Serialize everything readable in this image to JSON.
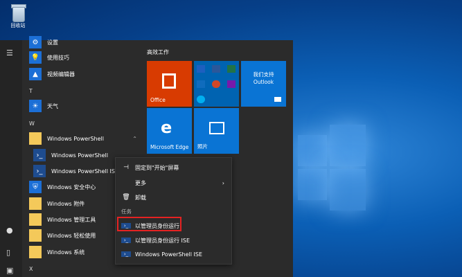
{
  "desktop": {
    "recycle_bin_label": "回收站"
  },
  "rail": {
    "icons": [
      "hamburger-icon",
      "user-icon",
      "document-icon",
      "pictures-icon"
    ]
  },
  "applist": {
    "rows": [
      {
        "label": "设置",
        "icon": "gear-icon"
      },
      {
        "label": "使用技巧",
        "icon": "lightbulb-icon"
      },
      {
        "label": "视频编辑器",
        "icon": "photos-icon"
      },
      {
        "label": "天气",
        "icon": "weather-icon"
      },
      {
        "label": "Windows PowerShell",
        "icon": "folder-icon"
      },
      {
        "label": "Windows PowerShell",
        "icon": "powershell-icon"
      },
      {
        "label": "Windows PowerShell ISE",
        "icon": "powershell-ise-icon"
      },
      {
        "label": "Windows 安全中心",
        "icon": "shield-icon"
      },
      {
        "label": "Windows 附件",
        "icon": "folder-icon"
      },
      {
        "label": "Windows 管理工具",
        "icon": "folder-icon"
      },
      {
        "label": "Windows 轻松使用",
        "icon": "folder-icon"
      },
      {
        "label": "Windows 系统",
        "icon": "folder-icon"
      }
    ],
    "letters": [
      "T",
      "W",
      "X"
    ]
  },
  "tiles": {
    "group_title": "高效工作",
    "office": "Office",
    "outlook_line1": "我们支持",
    "outlook_line2": "Outlook",
    "edge": "Microsoft Edge",
    "photos": "照片"
  },
  "context_menu": {
    "pin": "固定到\"开始\"屏幕",
    "more": "更多",
    "uninstall": "卸载",
    "section": "任务",
    "run_admin": "以管理员身份运行",
    "run_admin_ise": "以管理员身份运行 ISE",
    "ps_ise": "Windows PowerShell ISE"
  },
  "colors": {
    "accent": "#0078d7",
    "office": "#d83b01",
    "highlight": "#e52222"
  }
}
